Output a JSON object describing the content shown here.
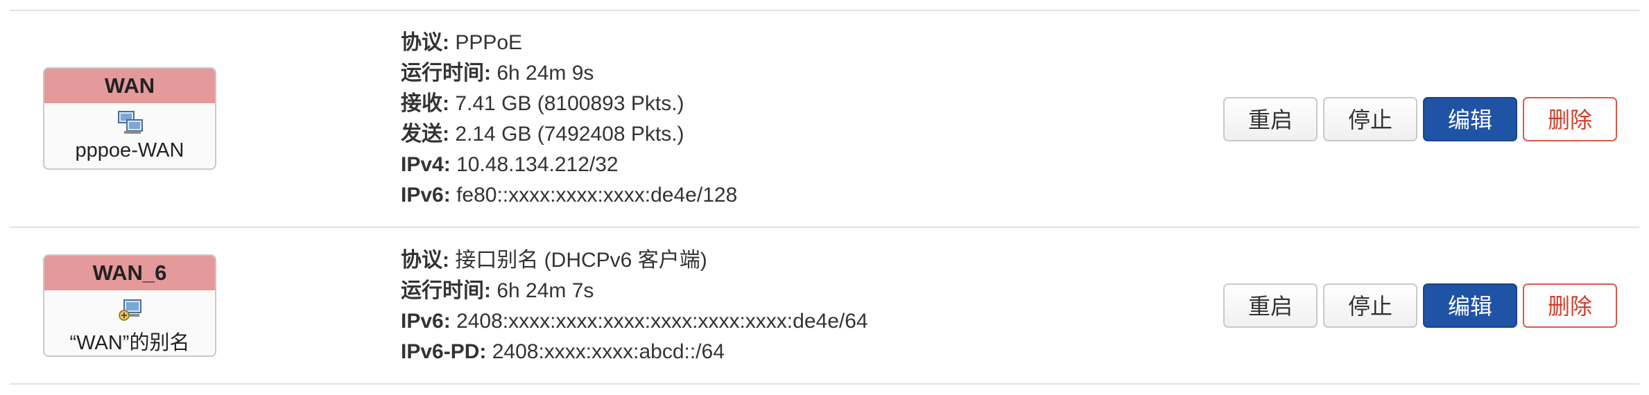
{
  "interfaces": [
    {
      "title": "WAN",
      "device": "pppoe-WAN",
      "icon": "network-computers-icon",
      "details": [
        {
          "label": "协议:",
          "value": "PPPoE"
        },
        {
          "label": "运行时间:",
          "value": "6h 24m 9s"
        },
        {
          "label": "接收:",
          "value": "7.41 GB (8100893 Pkts.)"
        },
        {
          "label": "发送:",
          "value": "2.14 GB (7492408 Pkts.)"
        },
        {
          "label": "IPv4:",
          "value": "10.48.134.212/32"
        },
        {
          "label": "IPv6:",
          "value": "fe80::xxxx:xxxx:xxxx:de4e/128"
        }
      ],
      "buttons": {
        "restart": "重启",
        "stop": "停止",
        "edit": "编辑",
        "delete": "删除"
      }
    },
    {
      "title": "WAN_6",
      "device": "“WAN”的别名",
      "icon": "alias-icon",
      "details": [
        {
          "label": "协议:",
          "value": "接口别名 (DHCPv6 客户端)"
        },
        {
          "label": "运行时间:",
          "value": "6h 24m 7s"
        },
        {
          "label": "IPv6:",
          "value": "2408:xxxx:xxxx:xxxx:xxxx:xxxx:xxxx:de4e/64"
        },
        {
          "label": "IPv6-PD:",
          "value": "2408:xxxx:xxxx:abcd::/64"
        }
      ],
      "buttons": {
        "restart": "重启",
        "stop": "停止",
        "edit": "编辑",
        "delete": "删除"
      }
    }
  ],
  "colors": {
    "badge_header": "#e49a9a",
    "edit_button": "#1f53a6",
    "delete_text": "#d23c2a",
    "divider": "#e2e2e2"
  }
}
